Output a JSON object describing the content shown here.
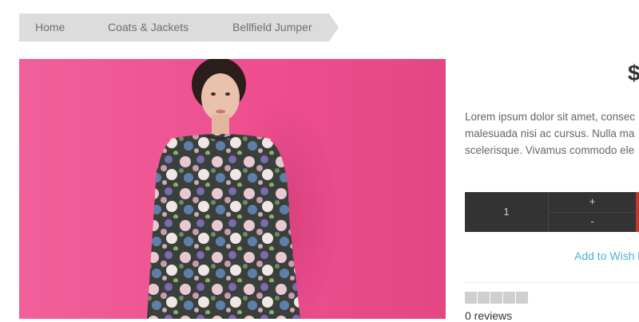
{
  "breadcrumb": {
    "items": [
      {
        "label": "Home"
      },
      {
        "label": "Coats & Jackets"
      },
      {
        "label": "Bellfield Jumper"
      }
    ]
  },
  "product": {
    "price_visible": "$",
    "description_lines": [
      "Lorem ipsum dolor sit amet, consec",
      "malesuada nisi ac cursus. Nulla ma",
      "scelerisque. Vivamus commodo ele"
    ],
    "quantity": "1",
    "increment_label": "+",
    "decrement_label": "-",
    "wishlist_label": "Add to Wish l",
    "rating": {
      "stars_total": 5,
      "stars_filled": 0
    },
    "reviews_label": "0 reviews"
  },
  "colors": {
    "backdrop_pink": "#ef4f8e",
    "qty_bar": "#333333",
    "cart_accent": "#c0392b",
    "link": "#4ab3d6",
    "breadcrumb_bg": "#dcdcdc"
  }
}
